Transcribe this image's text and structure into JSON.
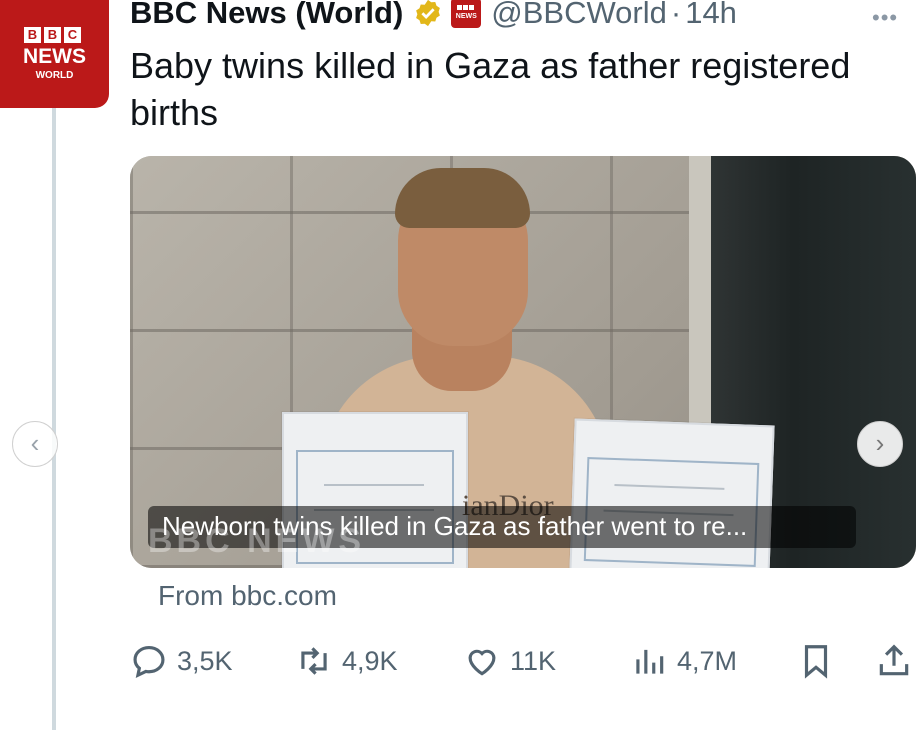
{
  "account": {
    "avatar_blocks": [
      "B",
      "B",
      "C"
    ],
    "avatar_news": "NEWS",
    "avatar_world": "WORLD",
    "display_name": "BBC News (World)",
    "mini_logo_text": "NEWS",
    "handle": "@BBCWorld",
    "separator": "·",
    "time": "14h"
  },
  "tweet": {
    "text": "Baby twins killed in Gaza as father registered births"
  },
  "card": {
    "image_text": "ianDior",
    "watermark": "BBC NEWS",
    "caption": "Newborn twins killed in Gaza as father went to re...",
    "source": "From bbc.com"
  },
  "stats": {
    "replies": "3,5K",
    "retweets": "4,9K",
    "likes": "11K",
    "views": "4,7M"
  },
  "colors": {
    "bbc_red": "#bb1919",
    "verified_gold": "#e2b719",
    "muted_text": "#536471"
  }
}
